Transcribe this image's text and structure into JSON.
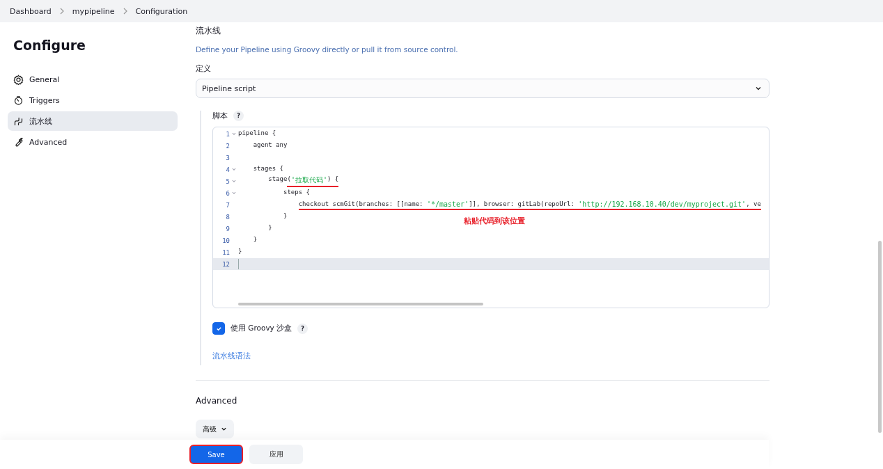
{
  "breadcrumbs": [
    "Dashboard",
    "mypipeline",
    "Configuration"
  ],
  "sidebar": {
    "title": "Configure",
    "items": [
      {
        "label": "General",
        "kind": "gear",
        "selected": false
      },
      {
        "label": "Triggers",
        "kind": "clock",
        "selected": false
      },
      {
        "label": "流水线",
        "kind": "pipeline",
        "selected": true
      },
      {
        "label": "Advanced",
        "kind": "wrench",
        "selected": false
      }
    ]
  },
  "section": {
    "title": "流水线",
    "description": "Define your Pipeline using Groovy directly or pull it from source control.",
    "definition_label": "定义",
    "definition_value": "Pipeline script"
  },
  "script": {
    "label": "脚本",
    "help": "?",
    "lines": [
      {
        "number": "1",
        "fold": true,
        "active": false,
        "tokens": [
          {
            "text": "pipeline {",
            "kind": "plain",
            "underlined": false
          }
        ]
      },
      {
        "number": "2",
        "fold": false,
        "active": false,
        "tokens": [
          {
            "text": "    agent any",
            "kind": "plain",
            "underlined": false
          }
        ]
      },
      {
        "number": "3",
        "fold": false,
        "active": false
      },
      {
        "number": "4",
        "fold": true,
        "active": false,
        "tokens": [
          {
            "text": "    stages {",
            "kind": "plain",
            "underlined": false
          }
        ]
      },
      {
        "number": "5",
        "fold": true,
        "active": false,
        "tokens": [
          {
            "text": "        stage",
            "kind": "plain",
            "underlined": false
          },
          {
            "text": "(",
            "kind": "plain",
            "underlined": true
          },
          {
            "text": "'拉取代码'",
            "kind": "string",
            "underlined": true
          },
          {
            "text": ") {",
            "kind": "plain",
            "underlined": true
          }
        ]
      },
      {
        "number": "6",
        "fold": true,
        "active": false,
        "tokens": [
          {
            "text": "            steps {",
            "kind": "plain",
            "underlined": false
          }
        ]
      },
      {
        "number": "7",
        "fold": false,
        "active": false,
        "tokens": [
          {
            "text": "                checkout scmGit(branches: [[name: ",
            "kind": "plain",
            "underlined": true
          },
          {
            "text": "'*/master'",
            "kind": "string",
            "underlined": true
          },
          {
            "text": "]], browser: gitLab(repoUrl: ",
            "kind": "plain",
            "underlined": true
          },
          {
            "text": "'http://192.168.10.40/dev/myproject.git'",
            "kind": "string",
            "underlined": true
          },
          {
            "text": ", ve",
            "kind": "plain",
            "underlined": true
          }
        ]
      },
      {
        "number": "8",
        "fold": false,
        "active": false,
        "tokens": [
          {
            "text": "            }",
            "kind": "plain",
            "underlined": false
          }
        ]
      },
      {
        "number": "9",
        "fold": false,
        "active": false,
        "tokens": [
          {
            "text": "        }",
            "kind": "plain",
            "underlined": false
          }
        ]
      },
      {
        "number": "10",
        "fold": false,
        "active": false,
        "tokens": [
          {
            "text": "    }",
            "kind": "plain",
            "underlined": false
          }
        ]
      },
      {
        "number": "11",
        "fold": false,
        "active": false,
        "tokens": [
          {
            "text": "}",
            "kind": "plain",
            "underlined": false
          }
        ]
      },
      {
        "number": "12",
        "fold": false,
        "active": true
      }
    ],
    "annotation": "粘贴代码到该位置",
    "sandbox": {
      "label": "使用 Groovy 沙盒",
      "checked": true,
      "help": "?"
    },
    "syntax_link": "流水线语法"
  },
  "advanced": {
    "title": "Advanced",
    "button": "高级"
  },
  "buttons": [
    {
      "label": "Save",
      "kind": "primary",
      "highlighted": true
    },
    {
      "label": "应用",
      "kind": "secondary",
      "highlighted": false
    }
  ]
}
